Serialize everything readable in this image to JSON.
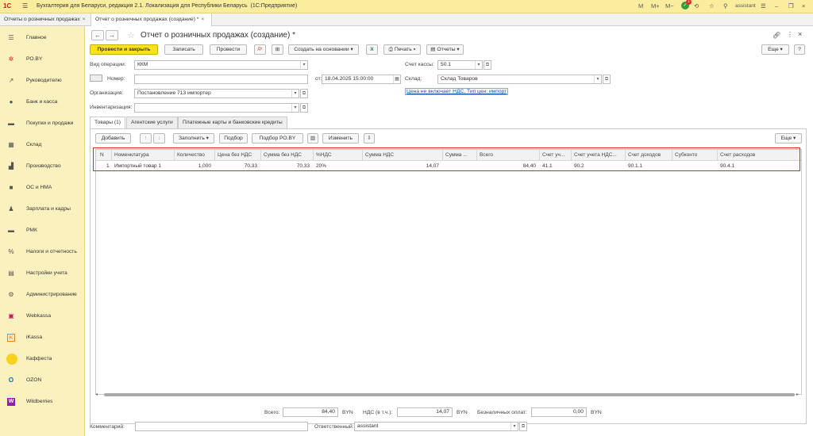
{
  "app": {
    "title": "Бухгалтерия для Беларуси, редакция 2.1. Локализация для Республики Беларусь",
    "platform": "(1С:Предприятие)",
    "logo": "1С",
    "header_icons": {
      "m1": "M",
      "m2": "M+",
      "m3": "M−"
    },
    "notif_count": "1",
    "user": "assistant"
  },
  "window_tabs": [
    {
      "label": "Отчеты о розничных продажах",
      "close": "×"
    },
    {
      "label": "Отчет о розничных продажах (создание) *",
      "close": "×"
    }
  ],
  "sidebar": {
    "items": [
      {
        "label": "Главное",
        "icon": "☰"
      },
      {
        "label": "РО.BY",
        "icon": "✲"
      },
      {
        "label": "Руководителю",
        "icon": "↗"
      },
      {
        "label": "Банк и касса",
        "icon": "●"
      },
      {
        "label": "Покупки и продажи",
        "icon": "▬"
      },
      {
        "label": "Склад",
        "icon": "▦"
      },
      {
        "label": "Производство",
        "icon": "▟"
      },
      {
        "label": "ОС и НМА",
        "icon": "■"
      },
      {
        "label": "Зарплата и кадры",
        "icon": "♟"
      },
      {
        "label": "РМК",
        "icon": "▬"
      },
      {
        "label": "Налоги и отчетность",
        "icon": "%"
      },
      {
        "label": "Настройки учета",
        "icon": "▤"
      },
      {
        "label": "Администрирование",
        "icon": "⚙"
      },
      {
        "label": "Webkassa",
        "icon": "▣"
      },
      {
        "label": "iKassa",
        "icon": "K"
      },
      {
        "label": "Каффеста",
        "icon": ""
      },
      {
        "label": "OZON",
        "icon": "O"
      },
      {
        "label": "Wildberries",
        "icon": "W"
      }
    ]
  },
  "document": {
    "title": "Отчет о розничных продажах (создание) *",
    "more": "Еще",
    "help": "?",
    "back": "←",
    "forward": "→"
  },
  "toolbar": {
    "post_close": "Провести и закрыть",
    "save": "Записать",
    "post": "Провести",
    "create_based": "Создать на основании",
    "print": "Печать",
    "reports": "Отчеты",
    "more": "Еще"
  },
  "form": {
    "operation_label": "Вид операции:",
    "operation_value": "ККМ",
    "number_label": "Номер:",
    "number_value": "",
    "date_label": "от:",
    "date_value": "18.04.2025 15:00:00",
    "org_label": "Организация:",
    "org_value": "Постановление 713 импортер",
    "inv_label": "Инвентаризация:",
    "inv_value": "",
    "cash_label": "Счет кассы:",
    "cash_value": "50.1",
    "warehouse_label": "Склад:",
    "warehouse_value": "Склад Товаров",
    "price_link": "Цена не включает НДС, Тип цен: импорт"
  },
  "inner_tabs": [
    {
      "label": "Товары (1)"
    },
    {
      "label": "Агентские услуги"
    },
    {
      "label": "Платежные карты и банковские кредиты"
    }
  ],
  "table_toolbar": {
    "add": "Добавить",
    "fill": "Заполнить",
    "pick": "Подбор",
    "pick_ro": "Подбор РО.BY",
    "change": "Изменить",
    "more": "Еще"
  },
  "table": {
    "columns": [
      "N",
      "Номенклатура",
      "Количество",
      "Цена без НДС",
      "Сумма без НДС",
      "%НДС",
      "Сумма НДС",
      "Сумма ...",
      "Всего",
      "Счет уч...",
      "Счет учета НДС...",
      "Счет доходов",
      "Субконто",
      "Счет расходов"
    ],
    "rows": [
      [
        "1",
        "Импортный товар 1",
        "1,000",
        "70,33",
        "70,33",
        "20%",
        "14,07",
        "",
        "84,40",
        "41.1",
        "90.2",
        "90.1.1",
        "",
        "90.4.1"
      ]
    ]
  },
  "totals": {
    "total_label": "Всего:",
    "total_value": "84,40",
    "currency": "BYN",
    "vat_label": "НДС (в т.ч.):",
    "vat_value": "14,07",
    "cashless_label": "Безналичных оплат:",
    "cashless_value": "0,00"
  },
  "footer": {
    "comment_label": "Комментарий:",
    "comment_value": "",
    "responsible_label": "Ответственный:",
    "responsible_value": "assistant"
  }
}
